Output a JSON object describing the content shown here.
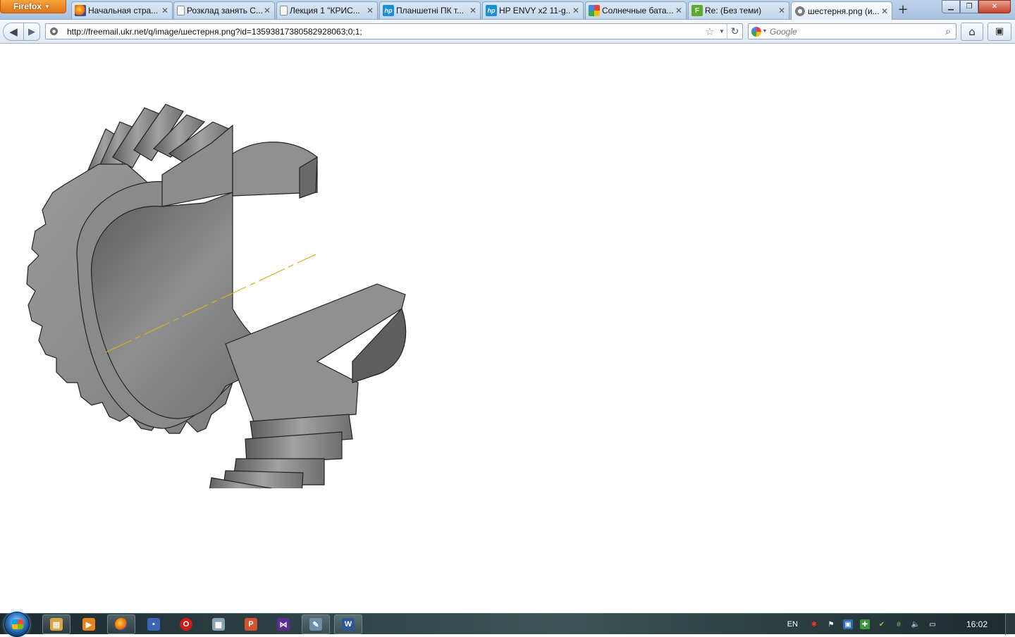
{
  "browser": {
    "app_button_label": "Firefox",
    "tabs": [
      {
        "title": "Начальная стра...",
        "icon": "firefox-icon"
      },
      {
        "title": "Розклад занять С...",
        "icon": "page-icon"
      },
      {
        "title": "Лекция 1 \"КРИС...",
        "icon": "page-icon"
      },
      {
        "title": "Планшетні ПК т...",
        "icon": "hp-icon"
      },
      {
        "title": "HP ENVY x2 11-g...",
        "icon": "hp-icon"
      },
      {
        "title": "Солнечные бата...",
        "icon": "google-icon"
      },
      {
        "title": "Re: (Без теми)",
        "icon": "f-icon"
      },
      {
        "title": "шестерня.png (и...",
        "icon": "gear-icon",
        "active": true
      }
    ],
    "url": "http://freemail.ukr.net/q/image/шестерня.png?id=13593817380582928063;0;1;",
    "search_placeholder": "Google"
  },
  "taskbar": {
    "apps": [
      {
        "name": "explorer",
        "icon": "folder-icon",
        "color": "#d9a441"
      },
      {
        "name": "media-player",
        "icon": "media-player-icon",
        "color": "#e8831d"
      },
      {
        "name": "firefox",
        "icon": "firefox-icon",
        "color": "#e66000",
        "active": true
      },
      {
        "name": "save",
        "icon": "floppy-icon",
        "color": "#3b63b8"
      },
      {
        "name": "opera",
        "icon": "opera-icon",
        "color": "#cc1b1b"
      },
      {
        "name": "calculator",
        "icon": "calculator-icon",
        "color": "#8aa3b5"
      },
      {
        "name": "powerpoint",
        "icon": "powerpoint-icon",
        "color": "#d35230"
      },
      {
        "name": "app-purple",
        "icon": "purple-app-icon",
        "color": "#5a2d91"
      },
      {
        "name": "paint",
        "icon": "paint-icon",
        "color": "#6c8ea8"
      },
      {
        "name": "word",
        "icon": "word-icon",
        "color": "#2b579a"
      }
    ],
    "language": "EN",
    "clock": "16:02"
  }
}
